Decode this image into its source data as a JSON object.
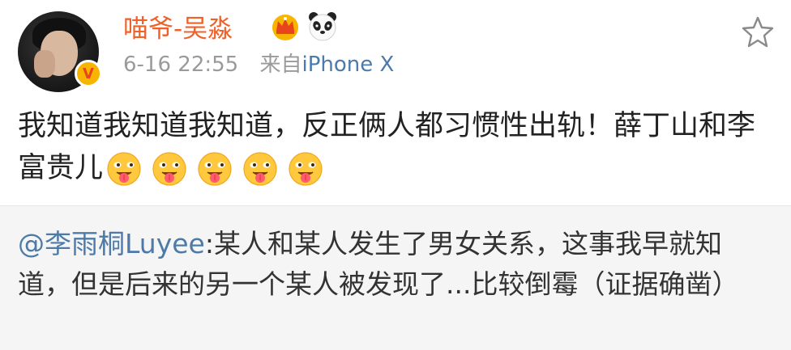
{
  "post": {
    "username": "喵爷-吴淼",
    "timestamp": "6-16 22:55",
    "source_prefix": "来自",
    "device": "iPhone X",
    "verified_badge": "V",
    "icons": [
      "crown-icon",
      "panda-icon",
      "star-icon"
    ],
    "text": "我知道我知道我知道，反正俩人都习惯性出轨！薛丁山和李富贵儿",
    "emoji_count": 5,
    "emoji_name": "tongue-out-emoji"
  },
  "retweet": {
    "user_mention": "@李雨桐Luyee",
    "text": ":某人和某人发生了男女关系，这事我早就知道，但是后来的另一个某人被发现了...比较倒霉（证据确凿）"
  },
  "colors": {
    "username": "#f0612a",
    "link": "#4d7aa8",
    "meta": "#9a9a9a",
    "retweet_bg": "#f5f5f5"
  }
}
